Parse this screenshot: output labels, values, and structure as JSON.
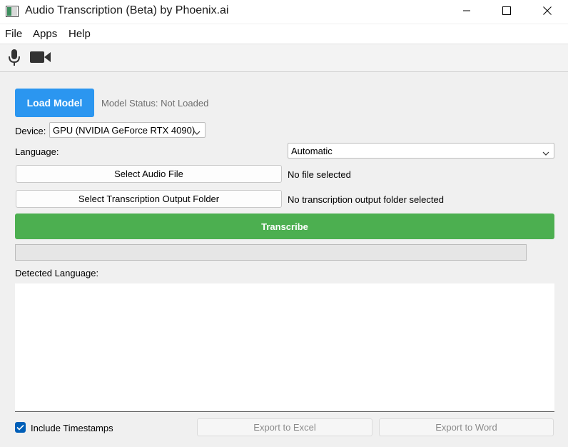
{
  "window": {
    "title": "Audio Transcription (Beta) by Phoenix.ai"
  },
  "menu": {
    "items": [
      "File",
      "Apps",
      "Help"
    ]
  },
  "toolbar": {
    "icons": [
      "microphone-icon",
      "video-camera-icon"
    ]
  },
  "model": {
    "load_button": "Load Model",
    "status": "Model Status: Not Loaded"
  },
  "device": {
    "label": "Device:",
    "value": "GPU (NVIDIA GeForce RTX 4090)"
  },
  "language": {
    "label": "Language:",
    "value": "Automatic"
  },
  "audio_file": {
    "button": "Select Audio File",
    "status": "No file selected"
  },
  "output_folder": {
    "button": "Select Transcription Output Folder",
    "status": "No transcription output folder selected"
  },
  "transcribe": {
    "button": "Transcribe"
  },
  "progress": {
    "value": 0
  },
  "detected_language": {
    "label": "Detected Language:"
  },
  "transcript": {
    "text": ""
  },
  "footer": {
    "timestamps_label": "Include Timestamps",
    "timestamps_checked": true,
    "export_excel": "Export to Excel",
    "export_word": "Export to Word"
  },
  "colors": {
    "load_button": "#2b96f0",
    "transcribe_button": "#4caf50",
    "checkbox": "#005fb8"
  }
}
